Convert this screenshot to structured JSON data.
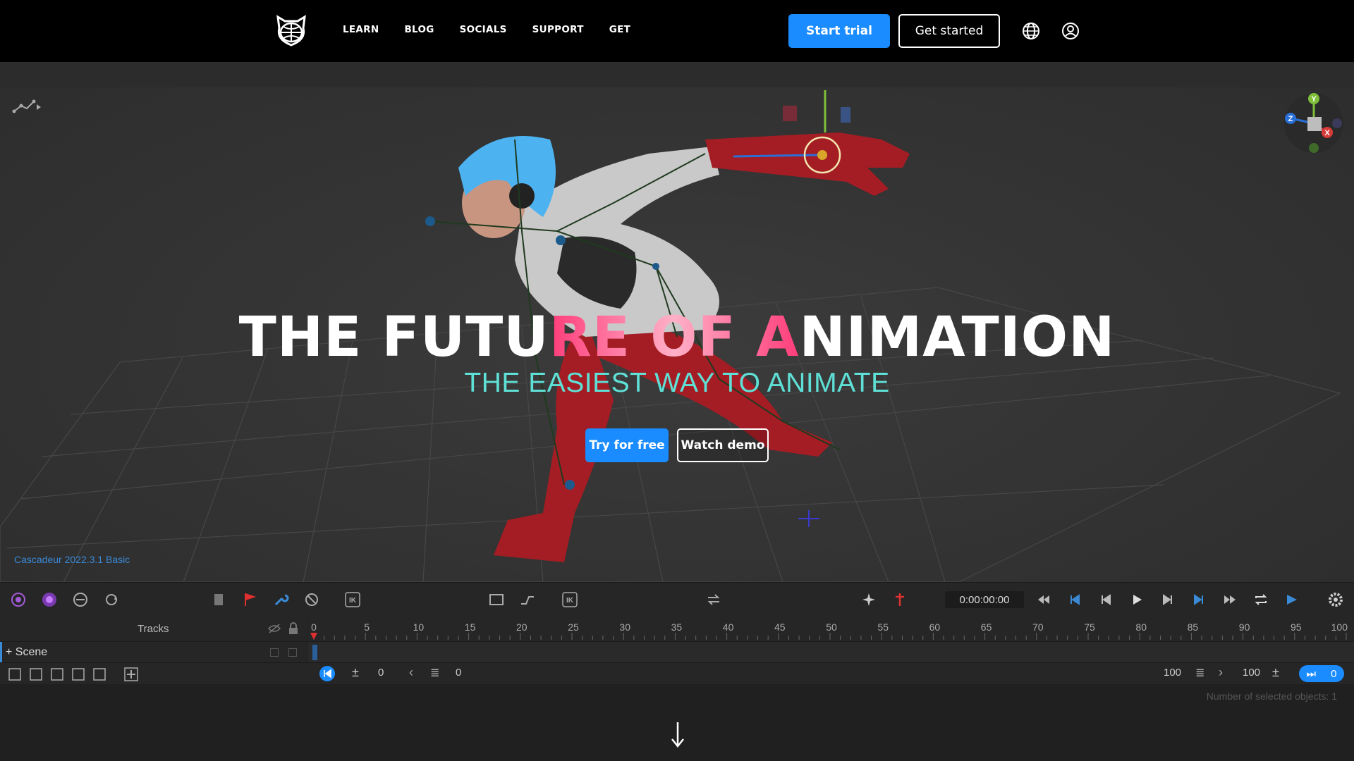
{
  "nav": {
    "links": [
      "LEARN",
      "BLOG",
      "SOCIALS",
      "SUPPORT",
      "GET"
    ],
    "start_trial": "Start trial",
    "get_started": "Get started",
    "icons": [
      "globe-icon",
      "account-icon"
    ]
  },
  "hero": {
    "title_part1": "THE FUTU",
    "title_hot": "RE OF A",
    "title_part2": "NIMATION",
    "subtitle": "THE EASIEST WAY TO ANIMATE",
    "try_free": "Try for free",
    "watch_demo": "Watch demo"
  },
  "viewport": {
    "version": "Cascadeur 2022.3.1 Basic",
    "gizmo_axes": [
      "Y",
      "Z",
      "X"
    ]
  },
  "timeline": {
    "time": "0:00:00:00",
    "tracks_label": "Tracks",
    "scene_label": "+ Scene",
    "ruler_ticks": [
      "0",
      "5",
      "10",
      "15",
      "20",
      "25",
      "30",
      "35",
      "40",
      "45",
      "50",
      "55",
      "60",
      "65",
      "70",
      "75",
      "80",
      "85",
      "90",
      "95",
      "100"
    ],
    "start_frame": "0",
    "current_frame": "0",
    "end_frame": "100",
    "end_frame2": "100",
    "frame_badge": "0",
    "status": "Number of selected objects: 1"
  },
  "colors": {
    "accent_blue": "#1a8cff",
    "subtitle_teal": "#5fe0d6",
    "hot_pink": "#ff3d7a",
    "version_blue": "#3b8ad6"
  }
}
